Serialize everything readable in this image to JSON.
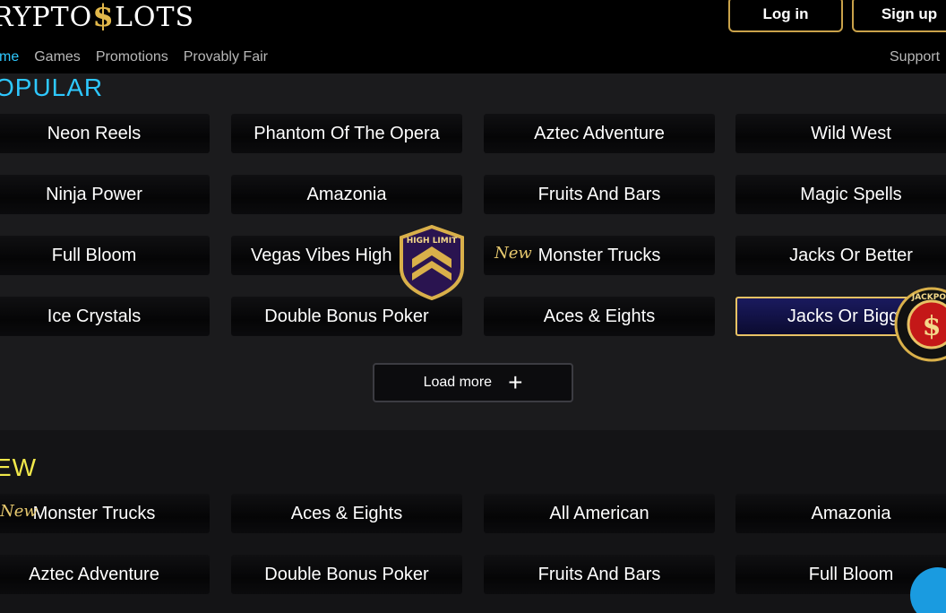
{
  "brand": {
    "logo_text_left": "RYPTO",
    "logo_symbol": "$",
    "logo_text_right": "LOTS"
  },
  "auth": {
    "login_label": "Log in",
    "signup_label": "Sign up"
  },
  "nav": {
    "items": [
      "me",
      "Games",
      "Promotions",
      "Provably Fair"
    ],
    "support_label": "Support"
  },
  "popular": {
    "title": "OPULAR",
    "games": [
      "Neon Reels",
      "Phantom Of The Opera",
      "Aztec Adventure",
      "Wild West",
      "Ninja Power",
      "Amazonia",
      "Fruits And Bars",
      "Magic Spells",
      "Full Bloom",
      "Vegas Vibes High",
      "Monster Trucks",
      "Jacks Or Better",
      "Ice Crystals",
      "Double Bonus Poker",
      "Aces & Eights",
      "Jacks Or Bigger"
    ],
    "load_more_label": "Load more",
    "load_more_icon": "+"
  },
  "new_section": {
    "title": "EW",
    "games": [
      "Monster Trucks",
      "Aces & Eights",
      "All American",
      "Amazonia",
      "Aztec Adventure",
      "Double Bonus Poker",
      "Fruits And Bars",
      "Full Bloom"
    ]
  },
  "tags": {
    "new_label": "New"
  },
  "badges": {
    "high_limit_text": "HIGH LIMIT",
    "jackpot_text": "JACKPOT"
  },
  "colors": {
    "accent_gold": "#c9a24a",
    "popular_title": "#2ec8ff",
    "new_title": "#f1e84a",
    "nav_active": "#2ec8ff"
  },
  "icons": {
    "chat": "chat-bubble-icon",
    "plus": "plus-icon"
  }
}
